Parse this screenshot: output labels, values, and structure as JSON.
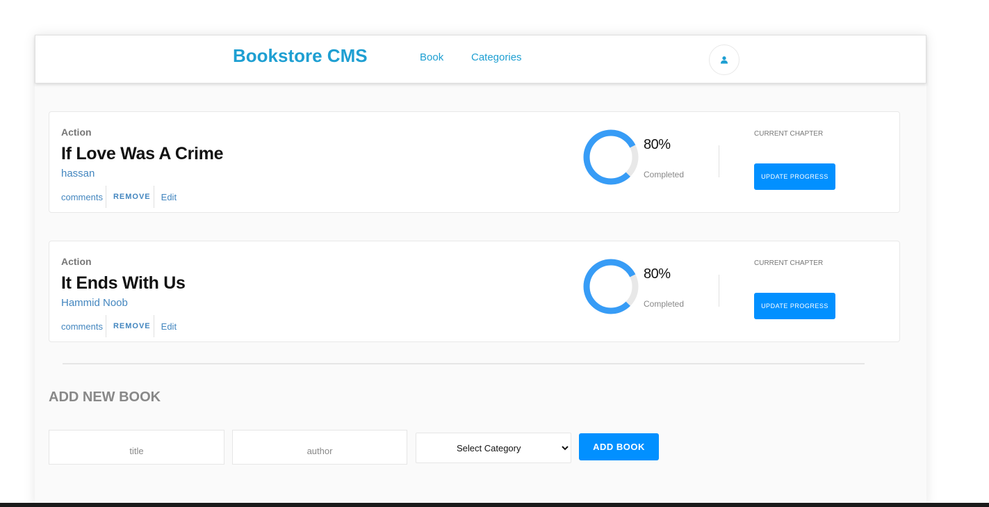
{
  "header": {
    "brand": "Bookstore CMS",
    "nav": [
      {
        "label": "Book"
      },
      {
        "label": "Categories"
      }
    ],
    "user_icon": "user-icon"
  },
  "books": [
    {
      "category": "Action",
      "title": "If Love Was A Crime",
      "author": "hassan",
      "actions": {
        "comments": "comments",
        "remove": "REMOVE",
        "edit": "Edit"
      },
      "progress_percent": 80,
      "progress_label": "80%",
      "completed_label": "Completed",
      "chapter_label": "CURRENT CHAPTER",
      "update_label": "UPDATE PROGRESS"
    },
    {
      "category": "Action",
      "title": "It Ends With Us",
      "author": "Hammid Noob",
      "actions": {
        "comments": "comments",
        "remove": "REMOVE",
        "edit": "Edit"
      },
      "progress_percent": 80,
      "progress_label": "80%",
      "completed_label": "Completed",
      "chapter_label": "CURRENT CHAPTER",
      "update_label": "UPDATE PROGRESS"
    }
  ],
  "form": {
    "heading": "ADD NEW BOOK",
    "title_placeholder": "title",
    "author_placeholder": "author",
    "category_selected": "Select Category",
    "submit_label": "ADD BOOK"
  },
  "colors": {
    "accent": "#1e9fd2",
    "link": "#4386bf",
    "button": "#0290ff",
    "progress": "#379cf6",
    "progress_track": "#e8e8e8"
  }
}
